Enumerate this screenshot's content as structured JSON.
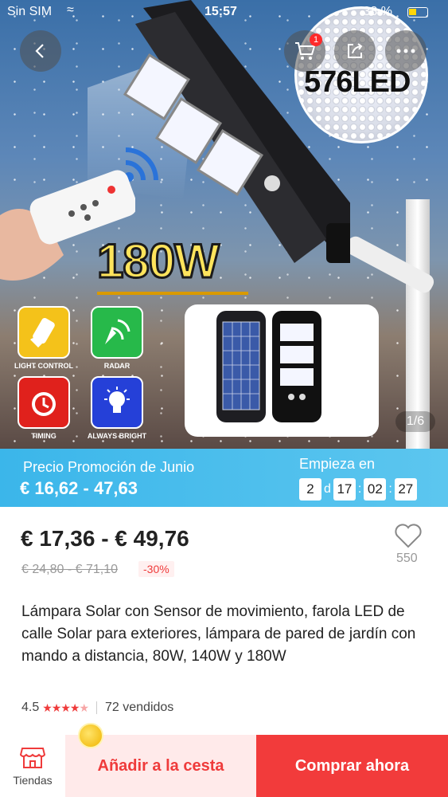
{
  "status_bar": {
    "carrier": "Sin SIM",
    "time": "15:57",
    "battery": "38 %"
  },
  "nav": {
    "cart_badge": "1"
  },
  "hero": {
    "led_label": "576LED",
    "wattage": "180W",
    "features": [
      {
        "label": "LIGHT CONTROL",
        "icon": "light-control-icon"
      },
      {
        "label": "RADAR",
        "icon": "radar-icon"
      },
      {
        "label": "TIMING",
        "icon": "alarm-clock-icon"
      },
      {
        "label": "ALWAYS BRIGHT",
        "icon": "lightbulb-icon"
      }
    ],
    "image_counter": "1/6"
  },
  "promo": {
    "title": "Precio Promoción de Junio",
    "price": "€ 16,62 - 47,63",
    "starts_label": "Empieza en",
    "days": "2",
    "days_unit": "d",
    "hours": "17",
    "minutes": "02",
    "seconds": "27",
    "separator": ":"
  },
  "product": {
    "price": "€ 17,36 - € 49,76",
    "original_price": "€ 24,80 - € 71,10",
    "discount": "-30%",
    "wishlist_count": "550",
    "title": "Lámpara Solar con Sensor de movimiento, farola LED de calle Solar para exteriores, lámpara de pared de jardín con mando a distancia, 80W, 140W y 180W",
    "rating": "4.5",
    "sold": "72 vendidos",
    "stars": 4.5
  },
  "bottom_bar": {
    "stores_label": "Tiendas",
    "add_to_cart": "Añadir a la cesta",
    "buy_now": "Comprar ahora"
  },
  "colors": {
    "accent_red": "#f23b3b",
    "promo_blue": "#3bb6ea"
  }
}
